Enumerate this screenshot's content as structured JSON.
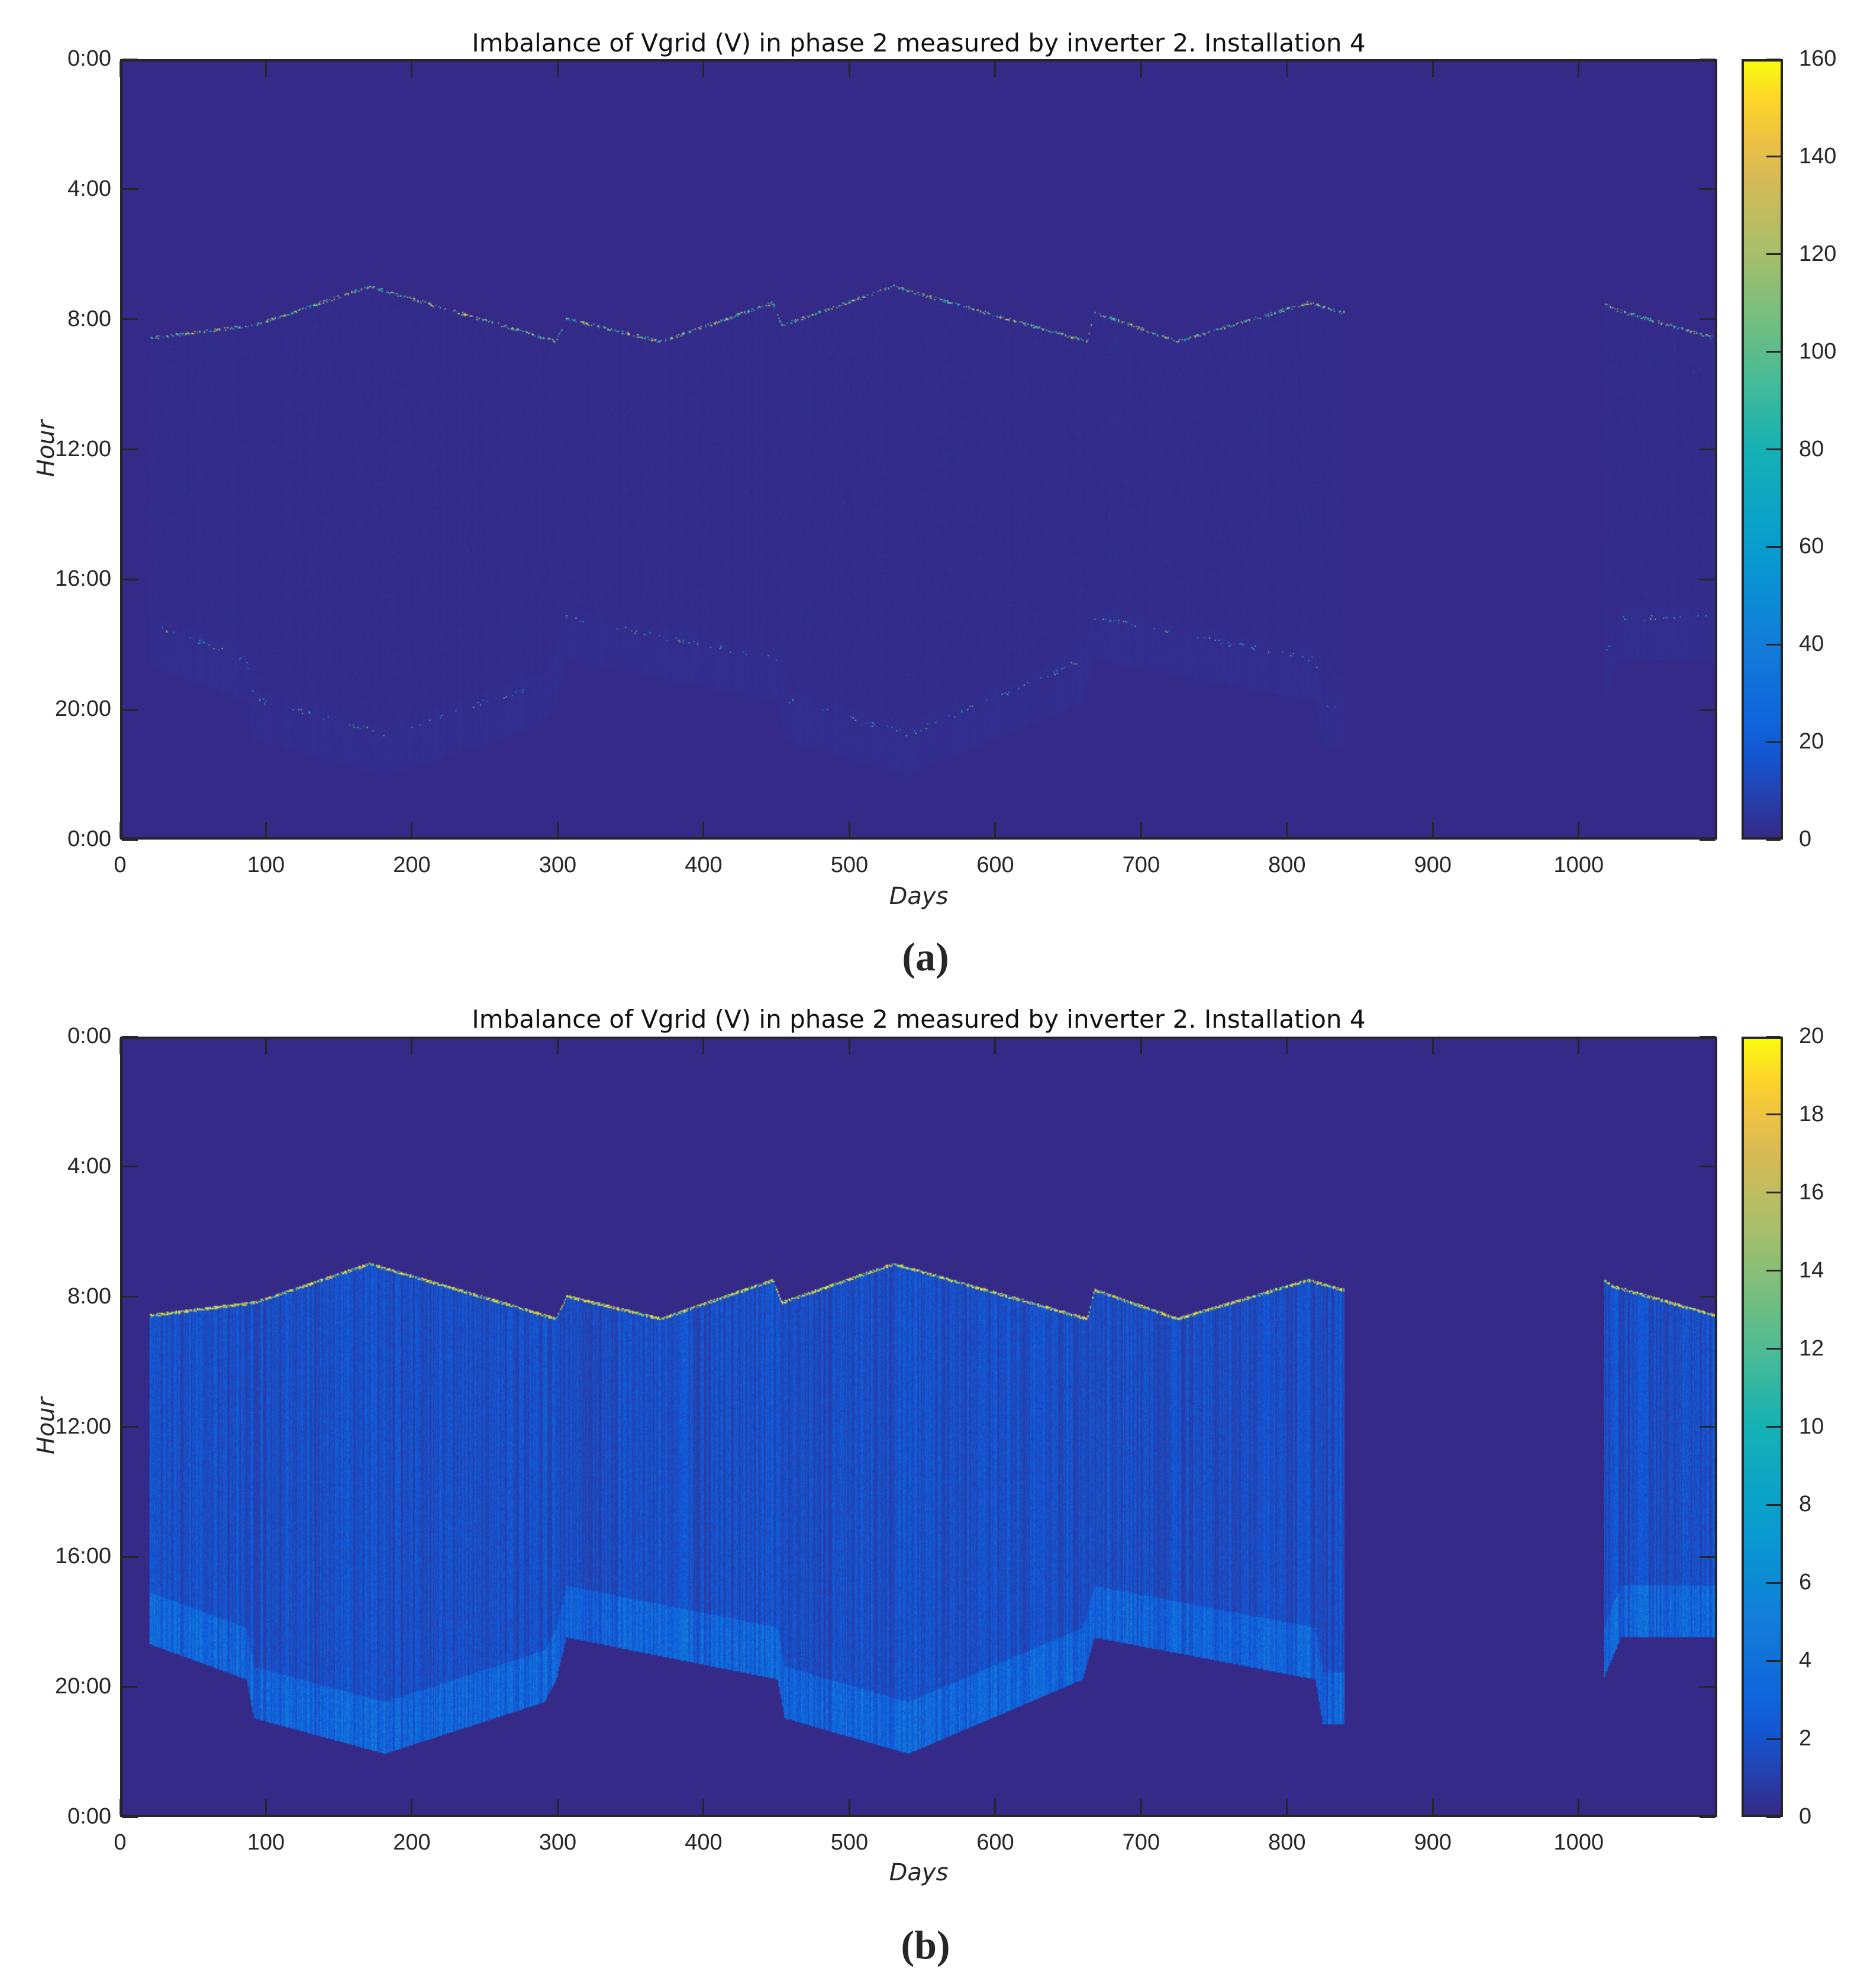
{
  "chart_data": [
    {
      "type": "heatmap",
      "panel_label": "(a)",
      "title": "Imbalance of Vgrid (V) in phase 2 measured by inverter 2. Installation 4",
      "xlabel": "Days",
      "ylabel": "Hour",
      "xlim": [
        0,
        1095
      ],
      "ylim_hours": [
        0,
        24
      ],
      "xticks": [
        "0",
        "100",
        "200",
        "300",
        "400",
        "500",
        "600",
        "700",
        "800",
        "900",
        "1000"
      ],
      "yticks": [
        "0:00",
        "4:00",
        "8:00",
        "12:00",
        "16:00",
        "20:00",
        "0:00"
      ],
      "colorbar": {
        "range": [
          0,
          160
        ],
        "ticks": [
          "0",
          "20",
          "40",
          "60",
          "80",
          "100",
          "120",
          "140",
          "160"
        ],
        "colormap": "parula"
      },
      "background_value": 0
    },
    {
      "type": "heatmap",
      "panel_label": "(b)",
      "title": "Imbalance of Vgrid (V) in phase 2 measured by inverter 2. Installation 4",
      "xlabel": "Days",
      "ylabel": "Hour",
      "xlim": [
        0,
        1095
      ],
      "ylim_hours": [
        0,
        24
      ],
      "xticks": [
        "0",
        "100",
        "200",
        "300",
        "400",
        "500",
        "600",
        "700",
        "800",
        "900",
        "1000"
      ],
      "yticks": [
        "0:00",
        "4:00",
        "8:00",
        "12:00",
        "16:00",
        "20:00",
        "0:00"
      ],
      "colorbar": {
        "range": [
          0,
          20
        ],
        "ticks": [
          "0",
          "2",
          "4",
          "6",
          "8",
          "10",
          "12",
          "14",
          "16",
          "18",
          "20"
        ],
        "colormap": "parula"
      },
      "background_value": 0
    }
  ],
  "data_coverage": {
    "data_periods_days": [
      [
        18,
        840
      ],
      [
        1018,
        1095
      ]
    ],
    "sunrise_edge_hours": [
      [
        18,
        8.5
      ],
      [
        90,
        8.1
      ],
      [
        170,
        6.9
      ],
      [
        298,
        8.6
      ],
      [
        305,
        7.9
      ],
      [
        370,
        8.6
      ],
      [
        447,
        7.4
      ],
      [
        453,
        8.1
      ],
      [
        530,
        6.9
      ],
      [
        663,
        8.6
      ],
      [
        668,
        7.7
      ],
      [
        725,
        8.6
      ],
      [
        815,
        7.4
      ],
      [
        838,
        7.7
      ],
      [
        1018,
        7.4
      ],
      [
        1025,
        7.6
      ],
      [
        1095,
        8.5
      ]
    ],
    "sunset_edge_hours": [
      [
        18,
        18.7
      ],
      [
        85,
        19.8
      ],
      [
        90,
        21.0
      ],
      [
        180,
        22.1
      ],
      [
        290,
        20.5
      ],
      [
        298,
        19.8
      ],
      [
        305,
        18.5
      ],
      [
        450,
        19.8
      ],
      [
        455,
        21.0
      ],
      [
        540,
        22.1
      ],
      [
        660,
        19.8
      ],
      [
        668,
        18.5
      ],
      [
        820,
        19.8
      ],
      [
        825,
        21.2
      ],
      [
        838,
        21.2
      ],
      [
        1018,
        19.8
      ],
      [
        1030,
        18.5
      ],
      [
        1095,
        18.5
      ]
    ]
  }
}
